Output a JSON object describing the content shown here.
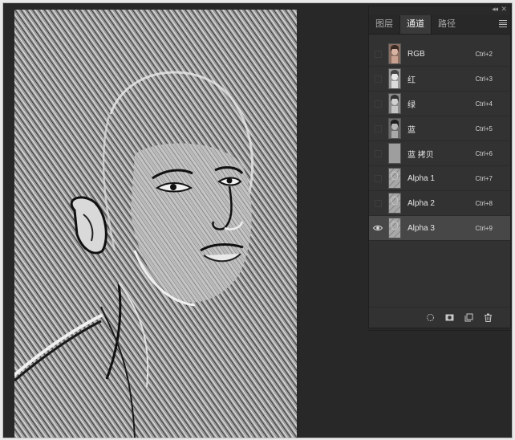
{
  "panel": {
    "tabs": [
      {
        "label": "图层",
        "active": false
      },
      {
        "label": "通道",
        "active": true
      },
      {
        "label": "路径",
        "active": false
      }
    ],
    "collapse_icon": "double-chevron-left-icon",
    "menu_icon": "panel-menu-icon",
    "channels": [
      {
        "label": "RGB",
        "shortcut": "Ctrl+2",
        "visible": false,
        "thumb": "color-portrait"
      },
      {
        "label": "红",
        "shortcut": "Ctrl+3",
        "visible": false,
        "thumb": "gray-portrait"
      },
      {
        "label": "绿",
        "shortcut": "Ctrl+4",
        "visible": false,
        "thumb": "gray-portrait"
      },
      {
        "label": "蓝",
        "shortcut": "Ctrl+5",
        "visible": false,
        "thumb": "dark-portrait"
      },
      {
        "label": "蓝 拷贝",
        "shortcut": "Ctrl+6",
        "visible": false,
        "thumb": "flat-gray"
      },
      {
        "label": "Alpha 1",
        "shortcut": "Ctrl+7",
        "visible": false,
        "thumb": "texture"
      },
      {
        "label": "Alpha 2",
        "shortcut": "Ctrl+8",
        "visible": false,
        "thumb": "texture"
      },
      {
        "label": "Alpha 3",
        "shortcut": "Ctrl+9",
        "visible": true,
        "active": true,
        "thumb": "texture"
      }
    ],
    "bottom_icons": [
      "load-selection-icon",
      "save-selection-mask-icon",
      "new-channel-icon",
      "delete-channel-icon"
    ]
  },
  "canvas": {
    "description_icon": "embossed-portrait-image"
  },
  "colors": {
    "workspace": "#282828",
    "panel": "#323232",
    "active_row": "#474747"
  }
}
